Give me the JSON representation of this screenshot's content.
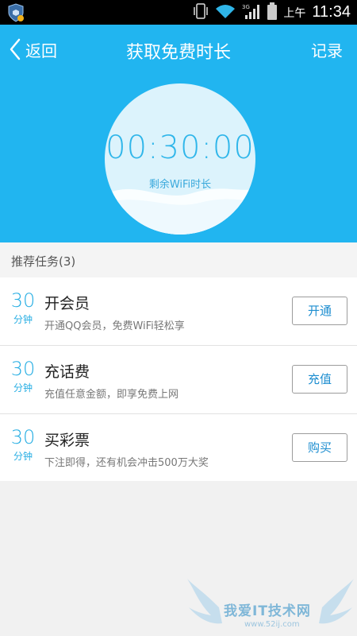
{
  "status_bar": {
    "am_label": "上午",
    "time": "11:34",
    "network_label": "3G"
  },
  "nav": {
    "back_label": "返回",
    "title": "获取免费时长",
    "record_label": "记录"
  },
  "timer": {
    "value": "00:30:00",
    "caption": "剩余WiFi时长"
  },
  "section": {
    "title": "推荐任务(3)"
  },
  "tasks": [
    {
      "amount": "30",
      "unit": "分钟",
      "title": "开会员",
      "desc": "开通QQ会员，免费WiFi轻松享",
      "button": "开通"
    },
    {
      "amount": "30",
      "unit": "分钟",
      "title": "充话费",
      "desc": "充值任意金额，即享免费上网",
      "button": "充值"
    },
    {
      "amount": "30",
      "unit": "分钟",
      "title": "买彩票",
      "desc": "下注即得，还有机会冲击500万大奖",
      "button": "购买"
    }
  ],
  "watermark": {
    "text": "我爱IT技术网",
    "url": "www.52ij.com"
  },
  "colors": {
    "header_bg": "#21b5f0",
    "accent": "#27aee3",
    "button_text": "#1e8ed0"
  }
}
